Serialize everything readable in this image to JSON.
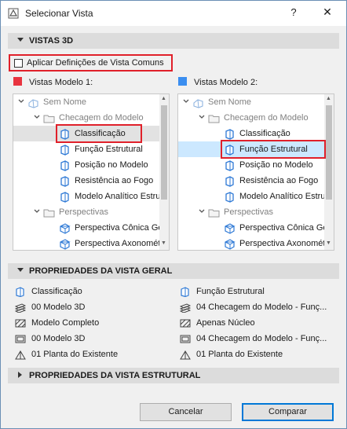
{
  "window": {
    "title": "Selecionar Vista",
    "help_label": "?",
    "close_label": "✕"
  },
  "sections": {
    "views3d": "VISTAS 3D",
    "general": "PROPRIEDADES DA VISTA GERAL",
    "structural": "PROPRIEDADES DA VISTA ESTRUTURAL"
  },
  "apply_common": {
    "label": "Aplicar Definições de Vista Comuns",
    "checked": false
  },
  "model1": {
    "label": "Vistas Modelo 1:",
    "swatch_color": "#e8343f",
    "tree": [
      {
        "text": "Sem Nome",
        "level": 0,
        "type": "root",
        "grey": true
      },
      {
        "text": "Checagem do Modelo",
        "level": 1,
        "type": "folder",
        "grey": true
      },
      {
        "text": "Classificação",
        "level": 2,
        "type": "view",
        "selected": true
      },
      {
        "text": "Função Estrutural",
        "level": 2,
        "type": "view"
      },
      {
        "text": "Posição no Modelo",
        "level": 2,
        "type": "view"
      },
      {
        "text": "Resistência ao Fogo",
        "level": 2,
        "type": "view"
      },
      {
        "text": "Modelo Analítico Estrutural",
        "level": 2,
        "type": "view"
      },
      {
        "text": "Perspectivas",
        "level": 1,
        "type": "folder",
        "grey": true
      },
      {
        "text": "Perspectiva Cônica Genérica",
        "level": 2,
        "type": "persp"
      },
      {
        "text": "Perspectiva Axonométrica",
        "level": 2,
        "type": "persp"
      }
    ]
  },
  "model2": {
    "label": "Vistas Modelo 2:",
    "swatch_color": "#3b8ef0",
    "tree": [
      {
        "text": "Sem Nome",
        "level": 0,
        "type": "root",
        "grey": true
      },
      {
        "text": "Checagem do Modelo",
        "level": 1,
        "type": "folder",
        "grey": true
      },
      {
        "text": "Classificação",
        "level": 2,
        "type": "view"
      },
      {
        "text": "Função Estrutural",
        "level": 2,
        "type": "view",
        "selected": true
      },
      {
        "text": "Posição no Modelo",
        "level": 2,
        "type": "view"
      },
      {
        "text": "Resistência ao Fogo",
        "level": 2,
        "type": "view"
      },
      {
        "text": "Modelo Analítico Estrutural",
        "level": 2,
        "type": "view"
      },
      {
        "text": "Perspectivas",
        "level": 1,
        "type": "folder",
        "grey": true
      },
      {
        "text": "Perspectiva Cônica Genérica",
        "level": 2,
        "type": "persp"
      },
      {
        "text": "Perspectiva Axonométrica",
        "level": 2,
        "type": "persp"
      }
    ]
  },
  "general_props": {
    "left": [
      {
        "icon": "view-icon",
        "text": "Classificação"
      },
      {
        "icon": "layer-icon",
        "text": "00 Modelo 3D"
      },
      {
        "icon": "hatch-icon",
        "text": "Modelo Completo"
      },
      {
        "icon": "display-icon",
        "text": "00 Modelo 3D"
      },
      {
        "icon": "plan-icon",
        "text": "01 Planta do Existente"
      }
    ],
    "right": [
      {
        "icon": "view-icon",
        "text": "Função Estrutural"
      },
      {
        "icon": "layer-icon",
        "text": "04 Checagem do Modelo - Funç..."
      },
      {
        "icon": "hatch-icon",
        "text": "Apenas Núcleo"
      },
      {
        "icon": "display-icon",
        "text": "04 Checagem do Modelo - Funç..."
      },
      {
        "icon": "plan-icon",
        "text": "01 Planta do Existente"
      }
    ]
  },
  "buttons": {
    "cancel": "Cancelar",
    "compare": "Comparar"
  },
  "colors": {
    "highlight_red": "#e0202a",
    "selection_blue": "#cce8ff",
    "view_icon_blue": "#2f7ad6"
  }
}
